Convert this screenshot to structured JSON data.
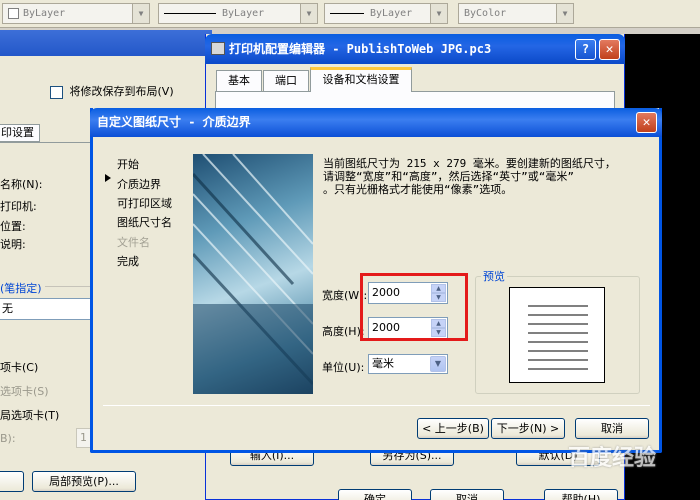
{
  "toolbar": {
    "combos": [
      {
        "label": "ByLayer"
      },
      {
        "label": "ByLayer"
      },
      {
        "label": "ByLayer"
      },
      {
        "label": "ByColor"
      }
    ]
  },
  "background_dialog": {
    "save_to_layout_label": "将修改保存到布局(V)",
    "tab_label": "印设置",
    "name_label": "名称(N):",
    "plotter_label": "打印机:",
    "location_label": "位置:",
    "description_label": "说明:",
    "plot_style_label": "(笔指定)",
    "plot_style_value": "无",
    "option1": "项卡(C)",
    "option2": "选项卡(S)",
    "option3": "局选项卡(T)",
    "option4": "B):",
    "option4_value": "1",
    "btn_partial_preview": "局部预览(P)..."
  },
  "plotter_window": {
    "title": "打印机配置编辑器 - PublishToWeb JPG.pc3",
    "tabs": [
      "基本",
      "端口",
      "设备和文档设置"
    ],
    "btn_import": "输入(I)...",
    "btn_save_as": "另存为(S)...",
    "btn_default": "默认(D)",
    "btn_ok": "确定",
    "btn_cancel": "取消",
    "btn_help": "帮助(H)"
  },
  "dialog": {
    "title": "自定义图纸尺寸 - 介质边界",
    "nav": [
      {
        "label": "开始",
        "active": false,
        "disabled": false
      },
      {
        "label": "介质边界",
        "active": true,
        "disabled": false
      },
      {
        "label": "可打印区域",
        "active": false,
        "disabled": false
      },
      {
        "label": "图纸尺寸名",
        "active": false,
        "disabled": false
      },
      {
        "label": "文件名",
        "active": false,
        "disabled": true
      },
      {
        "label": "完成",
        "active": false,
        "disabled": false
      }
    ],
    "description_line1": "当前图纸尺寸为 215 x 279 毫米。要创建新的图纸尺寸，",
    "description_line2": "请调整“宽度”和“高度”，然后选择“英寸”或“毫米”",
    "description_line3": "。只有光栅格式才能使用“像素”选项。",
    "width_label": "宽度(W):",
    "width_value": "2000",
    "height_label": "高度(H):",
    "height_value": "2000",
    "units_label": "单位(U):",
    "units_value": "毫米",
    "preview_label": "预览",
    "btn_back": "< 上一步(B)",
    "btn_next": "下一步(N) >",
    "btn_cancel": "取消"
  },
  "watermark": "百度经验",
  "colors": {
    "xp_blue": "#0a5ee0",
    "highlight_red": "#e41a1a",
    "dialog_bg": "#ece9d8"
  }
}
